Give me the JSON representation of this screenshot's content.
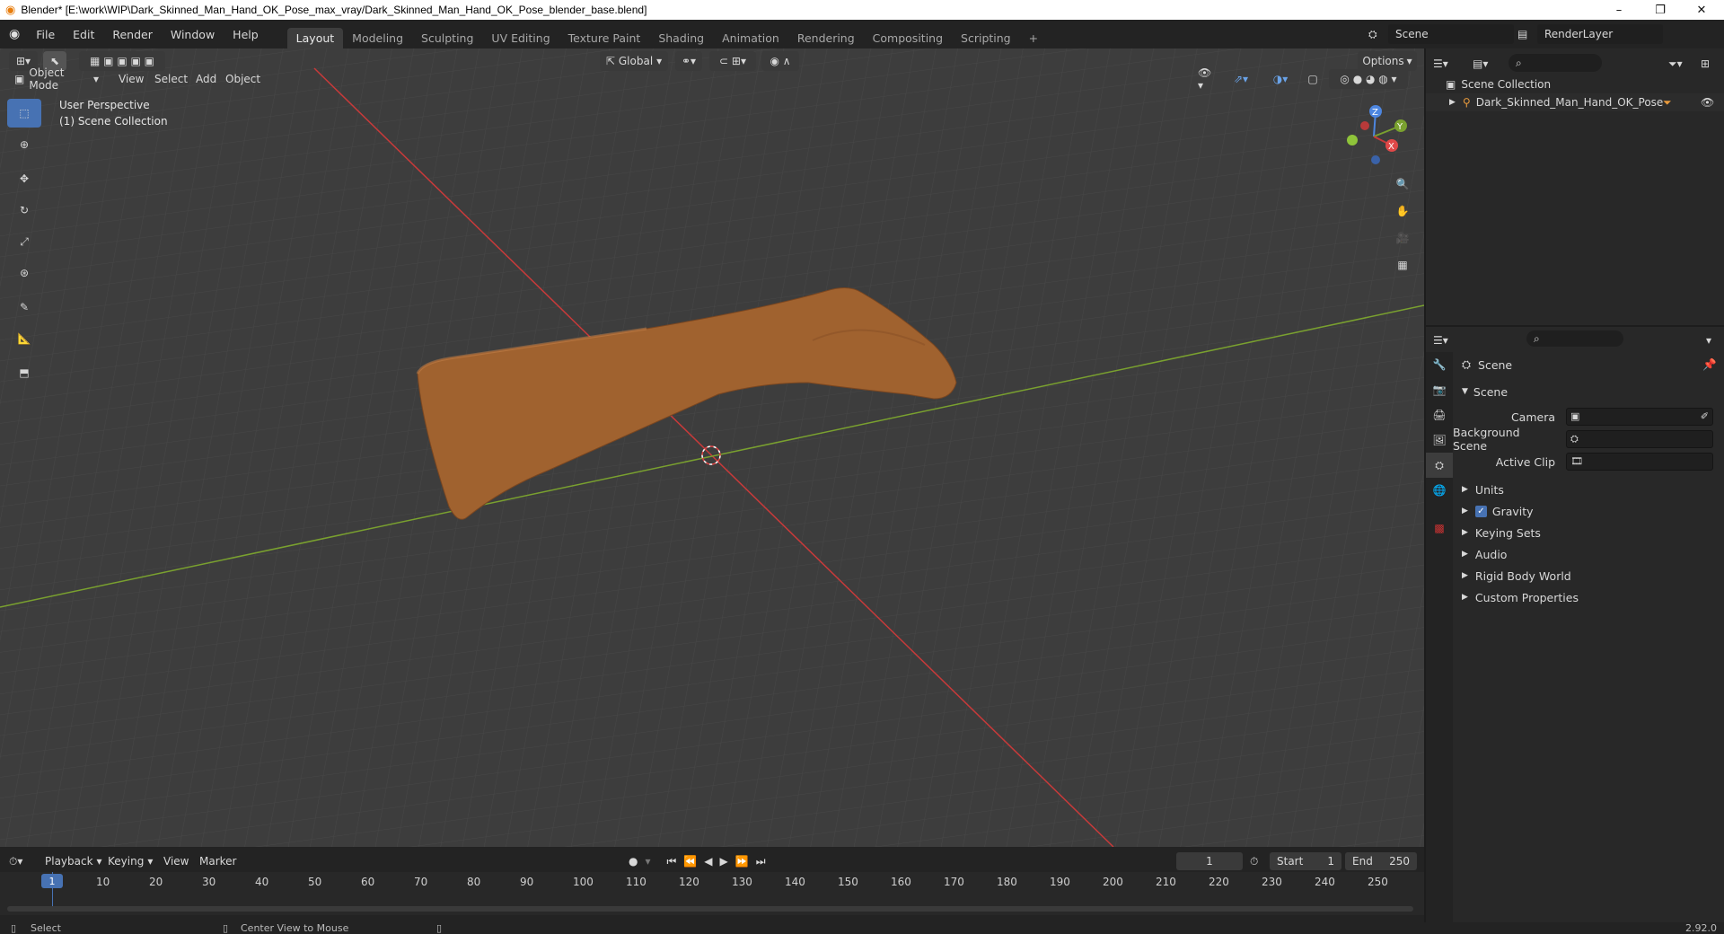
{
  "window": {
    "title": "Blender* [E:\\work\\WIP\\Dark_Skinned_Man_Hand_OK_Pose_max_vray/Dark_Skinned_Man_Hand_OK_Pose_blender_base.blend]",
    "minimize": "–",
    "maximize": "❐",
    "close": "✕"
  },
  "menubar": {
    "menus": [
      "File",
      "Edit",
      "Render",
      "Window",
      "Help"
    ],
    "workspaces": [
      "Layout",
      "Modeling",
      "Sculpting",
      "UV Editing",
      "Texture Paint",
      "Shading",
      "Animation",
      "Rendering",
      "Compositing",
      "Scripting"
    ],
    "active_workspace": "Layout",
    "add_workspace": "+",
    "scene_name": "Scene",
    "view_layer": "RenderLayer"
  },
  "viewport": {
    "mode": "Object Mode",
    "menus": [
      "View",
      "Select",
      "Add",
      "Object"
    ],
    "transform_orientation": "Global",
    "options": "Options",
    "overlay_title": "User Perspective",
    "overlay_subtitle": "(1) Scene Collection",
    "gizmo_labels": {
      "z": "Z",
      "y": "Y",
      "x": "X"
    }
  },
  "outliner": {
    "root": "Scene Collection",
    "items": [
      {
        "name": "Dark_Skinned_Man_Hand_OK_Pose"
      }
    ]
  },
  "properties": {
    "context": "Scene",
    "panel": "Scene",
    "fields": [
      {
        "label": "Camera",
        "value": ""
      },
      {
        "label": "Background Scene",
        "value": ""
      },
      {
        "label": "Active Clip",
        "value": ""
      }
    ],
    "subpanels": [
      "Units",
      "Gravity",
      "Keying Sets",
      "Audio",
      "Rigid Body World",
      "Custom Properties"
    ],
    "gravity_checked": true
  },
  "timeline": {
    "menus": [
      "Playback",
      "Keying",
      "View",
      "Marker"
    ],
    "current_frame": "1",
    "start_label": "Start",
    "start": "1",
    "end_label": "End",
    "end": "250",
    "ticks": [
      "1",
      "10",
      "20",
      "30",
      "40",
      "50",
      "60",
      "70",
      "80",
      "90",
      "100",
      "110",
      "120",
      "130",
      "140",
      "150",
      "160",
      "170",
      "180",
      "190",
      "200",
      "210",
      "220",
      "230",
      "240",
      "250"
    ]
  },
  "statusbar": {
    "left": "Select",
    "middle": "Center View to Mouse",
    "version": "2.92.0"
  },
  "colors": {
    "accent": "#4772b3",
    "x_axis": "#c83a3a",
    "y_axis": "#7aa12f",
    "skin": "#a0622f"
  }
}
